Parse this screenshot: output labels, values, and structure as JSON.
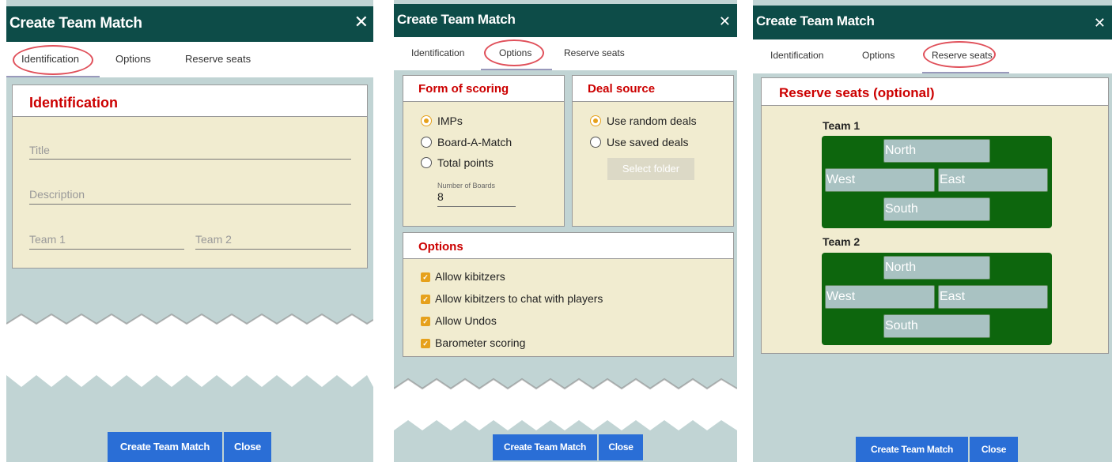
{
  "dialog": {
    "title": "Create Team Match",
    "close_icon": "close-icon",
    "tabs": [
      "Identification",
      "Options",
      "Reserve seats"
    ]
  },
  "identification": {
    "heading": "Identification",
    "title_placeholder": "Title",
    "description_placeholder": "Description",
    "team1_placeholder": "Team 1",
    "team2_placeholder": "Team 2"
  },
  "options_tab": {
    "scoring_heading": "Form of scoring",
    "scoring_options": [
      "IMPs",
      "Board-A-Match",
      "Total points"
    ],
    "scoring_selected": "IMPs",
    "boards_label": "Number of Boards",
    "boards_value": "8",
    "deal_heading": "Deal source",
    "deal_options": [
      "Use random deals",
      "Use saved deals"
    ],
    "deal_selected": "Use random deals",
    "select_folder_label": "Select folder",
    "options_heading": "Options",
    "checkboxes": [
      "Allow kibitzers",
      "Allow kibitzers to chat with players",
      "Allow Undos",
      "Barometer scoring"
    ]
  },
  "reserve_tab": {
    "heading": "Reserve seats (optional)",
    "teams": [
      {
        "name": "Team 1",
        "north": "North",
        "west": "West",
        "east": "East",
        "south": "South"
      },
      {
        "name": "Team 2",
        "north": "North",
        "west": "West",
        "east": "East",
        "south": "South"
      }
    ]
  },
  "footer": {
    "create_label": "Create Team Match",
    "close_label": "Close"
  },
  "colors": {
    "titlebar": "#0d4c48",
    "background": "#c1d4d4",
    "card": "#f1ecd0",
    "heading_red": "#cc0000",
    "accent_orange": "#e6a11c",
    "button_blue": "#2a6ed6",
    "table_green": "#0d660d",
    "highlight_ring": "#e0505a"
  }
}
